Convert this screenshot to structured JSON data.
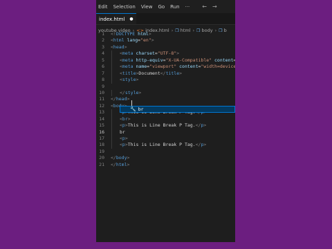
{
  "menubar": {
    "items": [
      "Edit",
      "Selection",
      "View",
      "Go",
      "Run",
      "···"
    ],
    "nav_back": "←",
    "nav_forward": "→"
  },
  "tab": {
    "label": "index.html",
    "dirty_marker": "●"
  },
  "breadcrumb": [
    "youtube video",
    "index.html",
    "html",
    "body",
    "b"
  ],
  "autocomplete": {
    "icon": "🔧",
    "label": "br"
  },
  "code": [
    {
      "num": "1",
      "indent": 0,
      "tokens": [
        [
          "b",
          "<!"
        ],
        [
          "t",
          "DOCTYPE"
        ],
        [
          "x",
          " "
        ],
        [
          "a",
          "html"
        ],
        [
          "b",
          ">"
        ]
      ]
    },
    {
      "num": "2",
      "indent": 0,
      "tokens": [
        [
          "b",
          "<"
        ],
        [
          "t",
          "html"
        ],
        [
          "x",
          " "
        ],
        [
          "a",
          "lang"
        ],
        [
          "x",
          "="
        ],
        [
          "s",
          "\"en\""
        ],
        [
          "b",
          ">"
        ]
      ]
    },
    {
      "num": "3",
      "indent": 0,
      "tokens": [
        [
          "b",
          "<"
        ],
        [
          "t",
          "head"
        ],
        [
          "b",
          ">"
        ]
      ]
    },
    {
      "num": "4",
      "indent": 1,
      "tokens": [
        [
          "b",
          "<"
        ],
        [
          "t",
          "meta"
        ],
        [
          "x",
          " "
        ],
        [
          "a",
          "charset"
        ],
        [
          "x",
          "="
        ],
        [
          "s",
          "\"UTF-8\""
        ],
        [
          "b",
          ">"
        ]
      ]
    },
    {
      "num": "5",
      "indent": 1,
      "tokens": [
        [
          "b",
          "<"
        ],
        [
          "t",
          "meta"
        ],
        [
          "x",
          " "
        ],
        [
          "a",
          "http-equiv"
        ],
        [
          "x",
          "="
        ],
        [
          "s",
          "\"X-UA-Compatible\""
        ],
        [
          "x",
          " "
        ],
        [
          "a",
          "content"
        ],
        [
          "x",
          "="
        ]
      ]
    },
    {
      "num": "6",
      "indent": 1,
      "tokens": [
        [
          "b",
          "<"
        ],
        [
          "t",
          "meta"
        ],
        [
          "x",
          " "
        ],
        [
          "a",
          "name"
        ],
        [
          "x",
          "="
        ],
        [
          "s",
          "\"viewport\""
        ],
        [
          "x",
          " "
        ],
        [
          "a",
          "content"
        ],
        [
          "x",
          "="
        ],
        [
          "s",
          "\"width=device"
        ]
      ]
    },
    {
      "num": "7",
      "indent": 1,
      "tokens": [
        [
          "b",
          "<"
        ],
        [
          "t",
          "title"
        ],
        [
          "b",
          ">"
        ],
        [
          "x",
          "Document"
        ],
        [
          "b",
          "</"
        ],
        [
          "t",
          "title"
        ],
        [
          "b",
          ">"
        ]
      ]
    },
    {
      "num": "8",
      "indent": 1,
      "tokens": [
        [
          "b",
          "<"
        ],
        [
          "t",
          "style"
        ],
        [
          "b",
          ">"
        ]
      ]
    },
    {
      "num": "9",
      "indent": 0,
      "tokens": []
    },
    {
      "num": "10",
      "indent": 1,
      "tokens": [
        [
          "b",
          "</"
        ],
        [
          "t",
          "style"
        ],
        [
          "b",
          ">"
        ]
      ]
    },
    {
      "num": "11",
      "indent": 0,
      "tokens": [
        [
          "b",
          "</"
        ],
        [
          "t",
          "head"
        ],
        [
          "b",
          ">"
        ]
      ]
    },
    {
      "num": "12",
      "indent": 0,
      "tokens": [
        [
          "b",
          "<"
        ],
        [
          "t",
          "body"
        ],
        [
          "b",
          ">"
        ]
      ]
    },
    {
      "num": "13",
      "indent": 1,
      "tokens": [
        [
          "b",
          "<"
        ],
        [
          "t",
          "p"
        ],
        [
          "b",
          ">"
        ],
        [
          "x",
          "This is Line Break P Tag."
        ],
        [
          "b",
          "</"
        ],
        [
          "t",
          "p"
        ],
        [
          "b",
          ">"
        ]
      ]
    },
    {
      "num": "14",
      "indent": 1,
      "tokens": [
        [
          "b",
          "<"
        ],
        [
          "t",
          "br"
        ],
        [
          "b",
          ">"
        ]
      ]
    },
    {
      "num": "15",
      "indent": 1,
      "tokens": [
        [
          "b",
          "<"
        ],
        [
          "t",
          "p"
        ],
        [
          "b",
          ">"
        ],
        [
          "x",
          "This is Line Break P Tag."
        ],
        [
          "b",
          "</"
        ],
        [
          "t",
          "p"
        ],
        [
          "b",
          ">"
        ]
      ]
    },
    {
      "num": "16",
      "indent": 1,
      "tokens": [
        [
          "x",
          "br"
        ]
      ]
    },
    {
      "num": "17",
      "indent": 1,
      "tokens": [
        [
          "b",
          "<"
        ],
        [
          "t",
          "p"
        ],
        [
          "b",
          ">"
        ]
      ]
    },
    {
      "num": "18",
      "indent": 1,
      "tokens": [
        [
          "b",
          "<"
        ],
        [
          "t",
          "p"
        ],
        [
          "b",
          ">"
        ],
        [
          "x",
          "This is Line Break P Tag."
        ],
        [
          "b",
          "</"
        ],
        [
          "t",
          "p"
        ],
        [
          "b",
          ">"
        ]
      ]
    },
    {
      "num": "19",
      "indent": 0,
      "tokens": []
    },
    {
      "num": "20",
      "indent": 0,
      "tokens": [
        [
          "b",
          "</"
        ],
        [
          "t",
          "body"
        ],
        [
          "b",
          ">"
        ]
      ]
    },
    {
      "num": "21",
      "indent": 0,
      "tokens": [
        [
          "b",
          "</"
        ],
        [
          "t",
          "html"
        ],
        [
          "b",
          ">"
        ]
      ]
    }
  ],
  "active_line": "16",
  "colors": {
    "background": "#6c1e80",
    "editor": "#1e1e1e",
    "tag": "#569cd6",
    "attribute": "#9cdcfe",
    "string": "#ce9178",
    "accent": "#0078d4"
  }
}
